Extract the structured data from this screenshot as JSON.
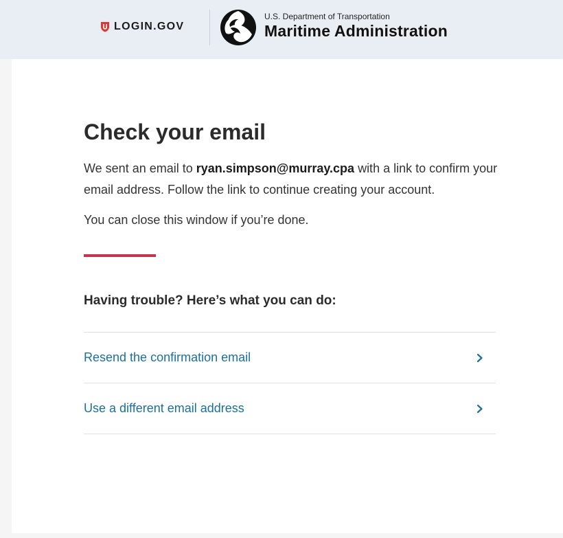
{
  "header": {
    "login_brand": "LOGIN.GOV",
    "agency_department": "U.S. Department of Transportation",
    "agency_name": "Maritime Administration",
    "background_color": "#e9eef5"
  },
  "main": {
    "title": "Check your email",
    "intro_prefix": "We sent an email to ",
    "email": "ryan.simpson@murray.cpa",
    "intro_suffix": " with a link to confirm your email address. Follow the link to continue creating your account.",
    "close_note": "You can close this window if you’re done.",
    "trouble_heading": "Having trouble? Here’s what you can do:",
    "options": [
      {
        "label": "Resend the confirmation email",
        "icon": "chevron-right-icon"
      },
      {
        "label": "Use a different email address",
        "icon": "chevron-right-icon"
      }
    ]
  },
  "colors": {
    "accent_rule": "#c8334b",
    "link": "#1a6fa0",
    "login_shield": "#d83933"
  }
}
